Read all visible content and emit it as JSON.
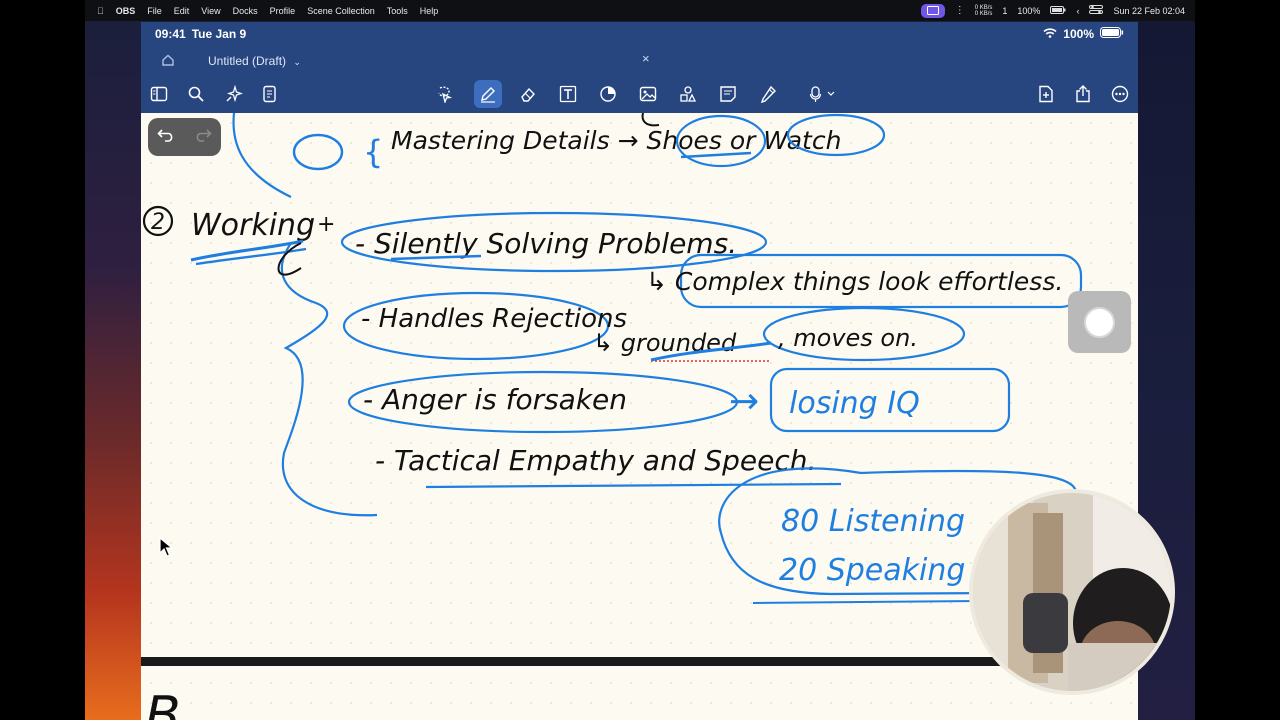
{
  "menubar": {
    "app": "OBS",
    "menus": [
      "File",
      "Edit",
      "View",
      "Docks",
      "Profile",
      "Scene Collection",
      "Tools",
      "Help"
    ],
    "net_up": "0 KB/s",
    "net_down": "0 KB/s",
    "count": "1",
    "battery": "100%",
    "clock": "Sun 22 Feb  02:04"
  },
  "ipad_status": {
    "time": "09:41",
    "date": "Tue Jan 9",
    "battery": "100%"
  },
  "tab": {
    "title": "Untitled (Draft)",
    "close": "×"
  },
  "toolbar_icons": [
    "sidebar-icon",
    "search-icon",
    "sparkle-icon",
    "document-icon",
    "lasso-icon",
    "pen-icon",
    "eraser-icon",
    "text-icon",
    "shapes-icon",
    "image-icon",
    "elements-icon",
    "sticky-note-icon",
    "highlighter-icon",
    "microphone-icon",
    "add-page-icon",
    "share-icon",
    "more-icon"
  ],
  "notes": {
    "circled_number": "2",
    "line_top": "Mastering Details → Shoes or Watch",
    "heading": "Working",
    "item1": "- Silently Solving Problems.",
    "item1_sub": "↳ Complex things look effortless.",
    "item2": "- Handles Rejections",
    "item2_sub_a": "↳ grounded",
    "item2_sub_b": ", moves on.",
    "item3": "- Anger is forsaken",
    "item3_arrow": "→",
    "item3_result": "losing IQ",
    "item4": "- Tactical Empathy and Speech.",
    "ratio_listening": "80 Listening",
    "ratio_speaking": "20 Speaking",
    "next_page_start": "B"
  },
  "colors": {
    "ink_black": "#111111",
    "ink_blue": "#1f7fe0",
    "accent": "#27467f"
  }
}
